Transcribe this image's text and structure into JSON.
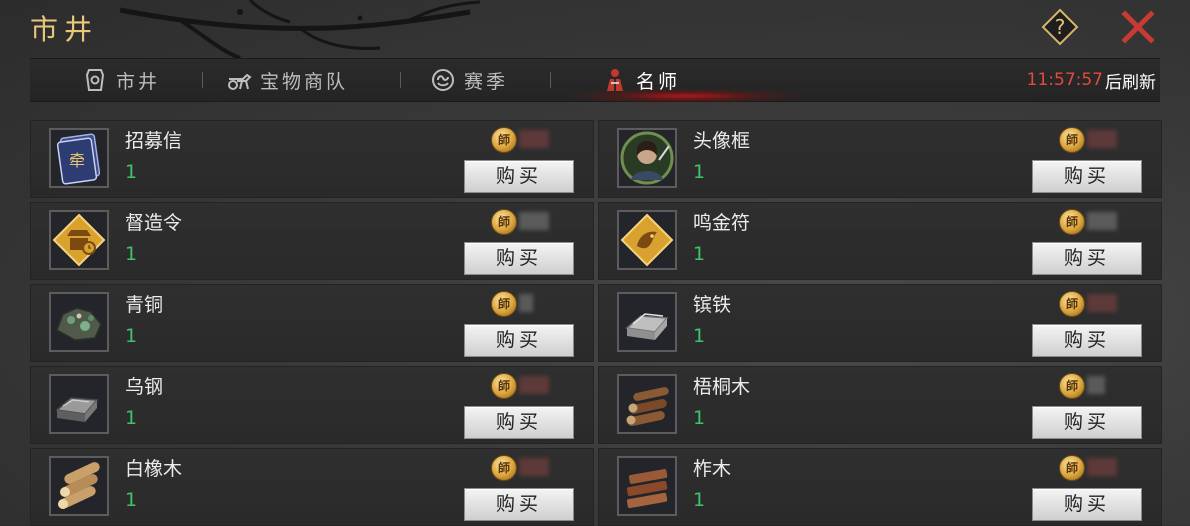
{
  "header": {
    "title": "市井",
    "help_icon": "question-icon",
    "close_icon": "close-icon"
  },
  "tabs": [
    {
      "label": "市井",
      "icon": "market-icon",
      "active": false
    },
    {
      "label": "宝物商队",
      "icon": "caravan-icon",
      "active": false
    },
    {
      "label": "赛季",
      "icon": "season-icon",
      "active": false
    },
    {
      "label": "名师",
      "icon": "master-icon",
      "active": true
    }
  ],
  "refresh": {
    "time": "11:57:57",
    "label": "后刷新"
  },
  "currency": {
    "coin_glyph": "師"
  },
  "buy_label": "购买",
  "items": [
    {
      "name": "招募信",
      "qty": "1",
      "icon": "recruit-letter-icon"
    },
    {
      "name": "头像框",
      "qty": "1",
      "icon": "avatar-frame-icon"
    },
    {
      "name": "督造令",
      "qty": "1",
      "icon": "supervise-order-icon"
    },
    {
      "name": "鸣金符",
      "qty": "1",
      "icon": "gong-talisman-icon"
    },
    {
      "name": "青铜",
      "qty": "1",
      "icon": "bronze-ore-icon"
    },
    {
      "name": "镔铁",
      "qty": "1",
      "icon": "iron-ingot-icon"
    },
    {
      "name": "乌钢",
      "qty": "1",
      "icon": "black-steel-icon"
    },
    {
      "name": "梧桐木",
      "qty": "1",
      "icon": "paulownia-wood-icon"
    },
    {
      "name": "白橡木",
      "qty": "1",
      "icon": "white-oak-icon"
    },
    {
      "name": "柞木",
      "qty": "1",
      "icon": "oak-wood-icon"
    }
  ],
  "colors": {
    "title_gold": "#e9c77a",
    "qty_green": "#3dc46b",
    "timer_red": "#e14a3f",
    "close_red": "#c83a34"
  }
}
